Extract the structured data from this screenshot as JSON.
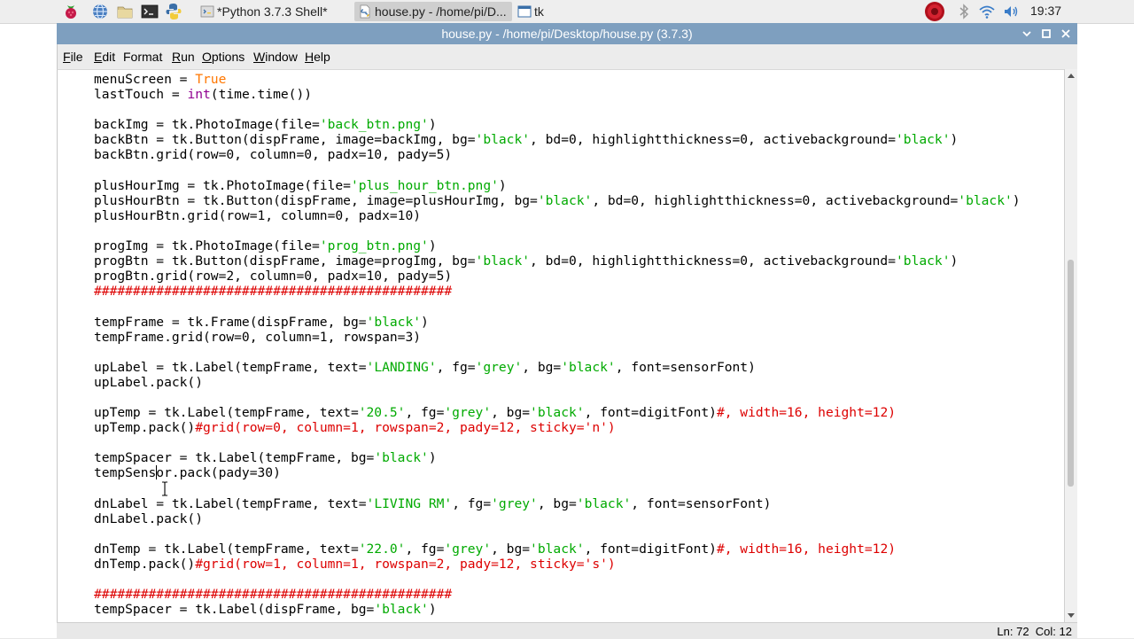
{
  "taskbar": {
    "launchers": [
      "raspberry-menu-icon",
      "web-browser-icon",
      "file-manager-icon",
      "terminal-icon",
      "python-icon"
    ],
    "tasks": [
      {
        "label": "*Python 3.7.3 Shell*",
        "icon": "python-shell-icon",
        "active": false
      },
      {
        "label": "house.py - /home/pi/D...",
        "icon": "python-file-icon",
        "active": true
      },
      {
        "label": "tk",
        "icon": "tk-window-icon",
        "active": false
      }
    ],
    "tray": [
      "shutdown-icon",
      "bluetooth-icon",
      "wifi-icon",
      "volume-icon"
    ],
    "time": "19:37"
  },
  "window": {
    "title": "house.py - /home/pi/Desktop/house.py (3.7.3)",
    "controls": [
      "minimize-icon",
      "maximize-icon",
      "close-icon"
    ]
  },
  "menubar": {
    "items": [
      {
        "label": "File",
        "u": "F",
        "rest": "ile"
      },
      {
        "label": "Edit",
        "u": "E",
        "rest": "dit"
      },
      {
        "label": "Format",
        "u": "",
        "rest": "Format"
      },
      {
        "label": "Run",
        "u": "R",
        "rest": "un"
      },
      {
        "label": "Options",
        "u": "O",
        "rest": "ptions"
      },
      {
        "label": "Window",
        "u": "W",
        "rest": "indow"
      },
      {
        "label": "Help",
        "u": "H",
        "rest": "elp"
      }
    ]
  },
  "editor": {
    "lines": [
      [
        [
          "menuScreen = ",
          ""
        ],
        [
          "True",
          "k"
        ]
      ],
      [
        [
          "lastTouch = ",
          ""
        ],
        [
          "int",
          "b"
        ],
        [
          "(time.time())",
          ""
        ]
      ],
      [],
      [
        [
          "backImg = tk.PhotoImage(file=",
          ""
        ],
        [
          "'back_btn.png'",
          "s"
        ],
        [
          ")",
          ""
        ]
      ],
      [
        [
          "backBtn = tk.Button(dispFrame, image=backImg, bg=",
          ""
        ],
        [
          "'black'",
          "s"
        ],
        [
          ", bd=0, highlightthickness=0, activebackground=",
          ""
        ],
        [
          "'black'",
          "s"
        ],
        [
          ")",
          ""
        ]
      ],
      [
        [
          "backBtn.grid(row=0, column=0, padx=10, pady=5)",
          ""
        ]
      ],
      [],
      [
        [
          "plusHourImg = tk.PhotoImage(file=",
          ""
        ],
        [
          "'plus_hour_btn.png'",
          "s"
        ],
        [
          ")",
          ""
        ]
      ],
      [
        [
          "plusHourBtn = tk.Button(dispFrame, image=plusHourImg, bg=",
          ""
        ],
        [
          "'black'",
          "s"
        ],
        [
          ", bd=0, highlightthickness=0, activebackground=",
          ""
        ],
        [
          "'black'",
          "s"
        ],
        [
          ")",
          ""
        ]
      ],
      [
        [
          "plusHourBtn.grid(row=1, column=0, padx=10)",
          ""
        ]
      ],
      [],
      [
        [
          "progImg = tk.PhotoImage(file=",
          ""
        ],
        [
          "'prog_btn.png'",
          "s"
        ],
        [
          ")",
          ""
        ]
      ],
      [
        [
          "progBtn = tk.Button(dispFrame, image=progImg, bg=",
          ""
        ],
        [
          "'black'",
          "s"
        ],
        [
          ", bd=0, highlightthickness=0, activebackground=",
          ""
        ],
        [
          "'black'",
          "s"
        ],
        [
          ")",
          ""
        ]
      ],
      [
        [
          "progBtn.grid(row=2, column=0, padx=10, pady=5)",
          ""
        ]
      ],
      [
        [
          "##############################################",
          "c"
        ]
      ],
      [],
      [
        [
          "tempFrame = tk.Frame(dispFrame, bg=",
          ""
        ],
        [
          "'black'",
          "s"
        ],
        [
          ")",
          ""
        ]
      ],
      [
        [
          "tempFrame.grid(row=0, column=1, rowspan=3)",
          ""
        ]
      ],
      [],
      [
        [
          "upLabel = tk.Label(tempFrame, text=",
          ""
        ],
        [
          "'LANDING'",
          "s"
        ],
        [
          ", fg=",
          ""
        ],
        [
          "'grey'",
          "s"
        ],
        [
          ", bg=",
          ""
        ],
        [
          "'black'",
          "s"
        ],
        [
          ", font=sensorFont)",
          ""
        ]
      ],
      [
        [
          "upLabel.pack()",
          ""
        ]
      ],
      [],
      [
        [
          "upTemp = tk.Label(tempFrame, text=",
          ""
        ],
        [
          "'20.5'",
          "s"
        ],
        [
          ", fg=",
          ""
        ],
        [
          "'grey'",
          "s"
        ],
        [
          ", bg=",
          ""
        ],
        [
          "'black'",
          "s"
        ],
        [
          ", font=digitFont)",
          ""
        ],
        [
          "#, width=16, height=12)",
          "c"
        ]
      ],
      [
        [
          "upTemp.pack()",
          ""
        ],
        [
          "#grid(row=0, column=1, rowspan=2, pady=12, sticky='n')",
          "c"
        ]
      ],
      [],
      [
        [
          "tempSpacer = tk.Label(tempFrame, bg=",
          ""
        ],
        [
          "'black'",
          "s"
        ],
        [
          ")",
          ""
        ]
      ],
      [
        [
          "tempSensor.pack(pady=30)",
          ""
        ]
      ],
      [],
      [
        [
          "dnLabel = tk.Label(tempFrame, text=",
          ""
        ],
        [
          "'LIVING RM'",
          "s"
        ],
        [
          ", fg=",
          ""
        ],
        [
          "'grey'",
          "s"
        ],
        [
          ", bg=",
          ""
        ],
        [
          "'black'",
          "s"
        ],
        [
          ", font=sensorFont)",
          ""
        ]
      ],
      [
        [
          "dnLabel.pack()",
          ""
        ]
      ],
      [],
      [
        [
          "dnTemp = tk.Label(tempFrame, text=",
          ""
        ],
        [
          "'22.0'",
          "s"
        ],
        [
          ", fg=",
          ""
        ],
        [
          "'grey'",
          "s"
        ],
        [
          ", bg=",
          ""
        ],
        [
          "'black'",
          "s"
        ],
        [
          ", font=digitFont)",
          ""
        ],
        [
          "#, width=16, height=12)",
          "c"
        ]
      ],
      [
        [
          "dnTemp.pack()",
          ""
        ],
        [
          "#grid(row=1, column=1, rowspan=2, pady=12, sticky='s')",
          "c"
        ]
      ],
      [],
      [
        [
          "##############################################",
          "c"
        ]
      ],
      [
        [
          "tempSpacer = tk.Label(dispFrame, bg=",
          ""
        ],
        [
          "'black'",
          "s"
        ],
        [
          ")",
          ""
        ]
      ]
    ]
  },
  "status": {
    "line": "Ln: 72",
    "col": "Col: 12"
  },
  "colors": {
    "titlebar": "#7e9fbf",
    "string": "#00aa00",
    "comment": "#dd0000",
    "builtin": "#900090",
    "keyword": "#ff7700"
  }
}
